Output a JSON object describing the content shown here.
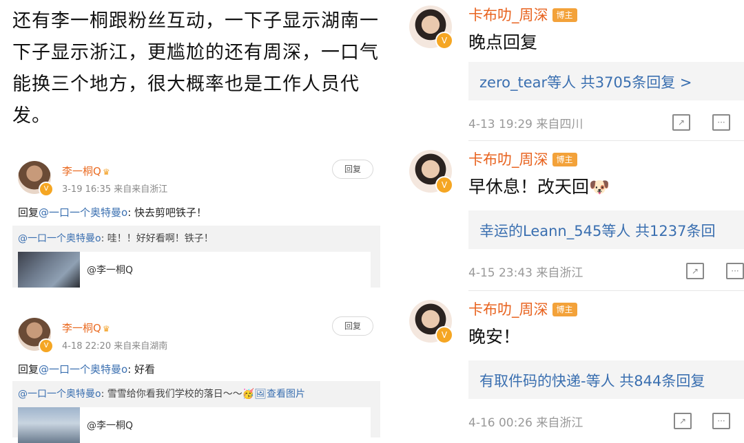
{
  "intro_text": "还有李一桐跟粉丝互动，一下子显示湖南一下子显示浙江，更尴尬的还有周深，一口气能换三个地方，很大概率也是工作人员代发。",
  "left_posts": [
    {
      "username": "李一桐Q",
      "meta": "3-19 16:35  来自来自浙江",
      "reply_button": "回复",
      "reply_prefix": "回复",
      "reply_mention": "@一口一个奥特曼o",
      "reply_body": ": 快去剪吧铁子！",
      "quote_mention": "@一口一个奥特曼o",
      "quote_body": ": 哇！！好好看啊！铁子！",
      "quote_extra": "",
      "media_user": "@李一桐Q"
    },
    {
      "username": "李一桐Q",
      "meta": "4-18 22:20  来自来自湖南",
      "reply_button": "回复",
      "reply_prefix": "回复",
      "reply_mention": "@一口一个奥特曼o",
      "reply_body": ": 好看",
      "quote_mention": "@一口一个奥特曼o",
      "quote_body": ": 雪雪给你看我们学校的落日～～",
      "quote_extra": "查看图片",
      "media_user": "@李一桐Q"
    }
  ],
  "right_comments": [
    {
      "username": "卡布叻_周深",
      "host_tag": "博主",
      "text": "晚点回复",
      "emoji": "",
      "reply_summary": "zero_tear等人  共3705条回复 >",
      "meta": "4-13 19:29  来自四川"
    },
    {
      "username": "卡布叻_周深",
      "host_tag": "博主",
      "text": "早休息！改天回",
      "emoji": "🐶",
      "reply_summary": "幸运的Leann_545等人  共1237条回",
      "meta": "4-15 23:43  来自浙江"
    },
    {
      "username": "卡布叻_周深",
      "host_tag": "博主",
      "text": "晚安！",
      "emoji": "",
      "reply_summary": "有取件码的快递-等人  共844条回复",
      "meta": "4-16 00:26  来自浙江"
    }
  ]
}
